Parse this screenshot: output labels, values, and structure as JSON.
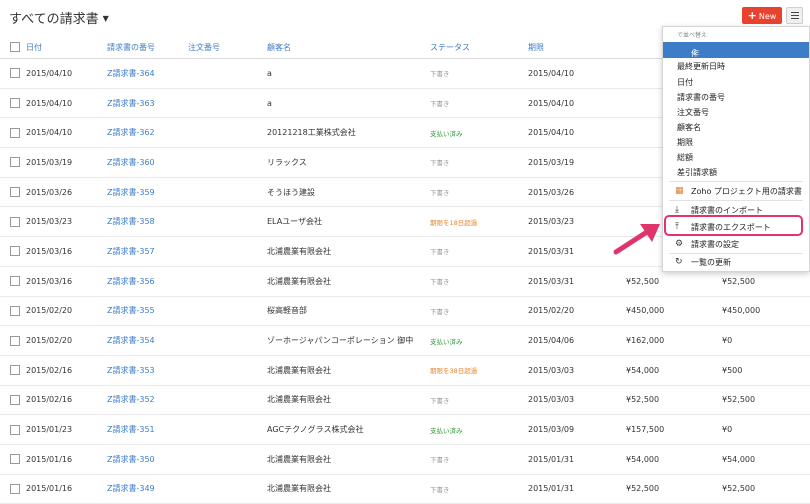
{
  "header": {
    "title": "すべての請求書",
    "new_label": "New"
  },
  "table": {
    "columns": [
      "日付",
      "請求書の番号",
      "注文番号",
      "顧客名",
      "ステータス",
      "期限",
      "",
      ""
    ],
    "rows": [
      {
        "date": "2015/04/10",
        "number": "Z請求書-364",
        "order": "",
        "customer": "a",
        "status": "下書き",
        "status_type": "draft",
        "due": "2015/04/10",
        "total": "",
        "balance": ""
      },
      {
        "date": "2015/04/10",
        "number": "Z請求書-363",
        "order": "",
        "customer": "a",
        "status": "下書き",
        "status_type": "draft",
        "due": "2015/04/10",
        "total": "",
        "balance": ""
      },
      {
        "date": "2015/04/10",
        "number": "Z請求書-362",
        "order": "",
        "customer": "20121218工業株式会社",
        "status": "支払い済み",
        "status_type": "paid",
        "due": "2015/04/10",
        "total": "",
        "balance": ""
      },
      {
        "date": "2015/03/19",
        "number": "Z請求書-360",
        "order": "",
        "customer": "リラックス",
        "status": "下書き",
        "status_type": "draft",
        "due": "2015/03/19",
        "total": "",
        "balance": ""
      },
      {
        "date": "2015/03/26",
        "number": "Z請求書-359",
        "order": "",
        "customer": "そうほう建設",
        "status": "下書き",
        "status_type": "draft",
        "due": "2015/03/26",
        "total": "",
        "balance": ""
      },
      {
        "date": "2015/03/23",
        "number": "Z請求書-358",
        "order": "",
        "customer": "ELAユーザ会社",
        "status": "期限を18日超過",
        "status_type": "over",
        "due": "2015/03/23",
        "total": "",
        "balance": ""
      },
      {
        "date": "2015/03/16",
        "number": "Z請求書-357",
        "order": "",
        "customer": "北浦農業有限会社",
        "status": "下書き",
        "status_type": "draft",
        "due": "2015/03/31",
        "total": "",
        "balance": ""
      },
      {
        "date": "2015/03/16",
        "number": "Z請求書-356",
        "order": "",
        "customer": "北浦農業有限会社",
        "status": "下書き",
        "status_type": "draft",
        "due": "2015/03/31",
        "total": "¥52,500",
        "balance": "¥52,500"
      },
      {
        "date": "2015/02/20",
        "number": "Z請求書-355",
        "order": "",
        "customer": "桜高軽音部",
        "status": "下書き",
        "status_type": "draft",
        "due": "2015/02/20",
        "total": "¥450,000",
        "balance": "¥450,000"
      },
      {
        "date": "2015/02/20",
        "number": "Z請求書-354",
        "order": "",
        "customer": "ゾーホージャパンコーポレーション 御中",
        "status": "支払い済み",
        "status_type": "paid",
        "due": "2015/04/06",
        "total": "¥162,000",
        "balance": "¥0"
      },
      {
        "date": "2015/02/16",
        "number": "Z請求書-353",
        "order": "",
        "customer": "北浦農業有限会社",
        "status": "期限を38日超過",
        "status_type": "over",
        "due": "2015/03/03",
        "total": "¥54,000",
        "balance": "¥500"
      },
      {
        "date": "2015/02/16",
        "number": "Z請求書-352",
        "order": "",
        "customer": "北浦農業有限会社",
        "status": "下書き",
        "status_type": "draft",
        "due": "2015/03/03",
        "total": "¥52,500",
        "balance": "¥52,500"
      },
      {
        "date": "2015/01/23",
        "number": "Z請求書-351",
        "order": "",
        "customer": "AGCテクノグラス株式会社",
        "status": "支払い済み",
        "status_type": "paid",
        "due": "2015/03/09",
        "total": "¥157,500",
        "balance": "¥0"
      },
      {
        "date": "2015/01/16",
        "number": "Z請求書-350",
        "order": "",
        "customer": "北浦農業有限会社",
        "status": "下書き",
        "status_type": "draft",
        "due": "2015/01/31",
        "total": "¥54,000",
        "balance": "¥54,000"
      },
      {
        "date": "2015/01/16",
        "number": "Z請求書-349",
        "order": "",
        "customer": "北浦農業有限会社",
        "status": "下書き",
        "status_type": "draft",
        "due": "2015/01/31",
        "total": "¥52,500",
        "balance": "¥52,500"
      }
    ]
  },
  "sort_menu": {
    "heading": "で並べ替え",
    "selected": "作成日時",
    "items": [
      "最終更新日時",
      "日付",
      "請求書の番号",
      "注文番号",
      "顧客名",
      "期限",
      "総額",
      "差引請求額"
    ],
    "actions": [
      {
        "icon": "zoho-projects-icon",
        "label": "Zoho プロジェクト用の請求書"
      },
      {
        "icon": "import-icon",
        "label": "請求書のインポート"
      },
      {
        "icon": "export-icon",
        "label": "請求書のエクスポート"
      },
      {
        "icon": "gear-icon",
        "label": "請求書の設定"
      },
      {
        "icon": "refresh-icon",
        "label": "一覧の更新"
      }
    ]
  },
  "colors": {
    "accent": "#3d7cc9",
    "new_button": "#e8432e",
    "highlight": "#e0356a"
  }
}
